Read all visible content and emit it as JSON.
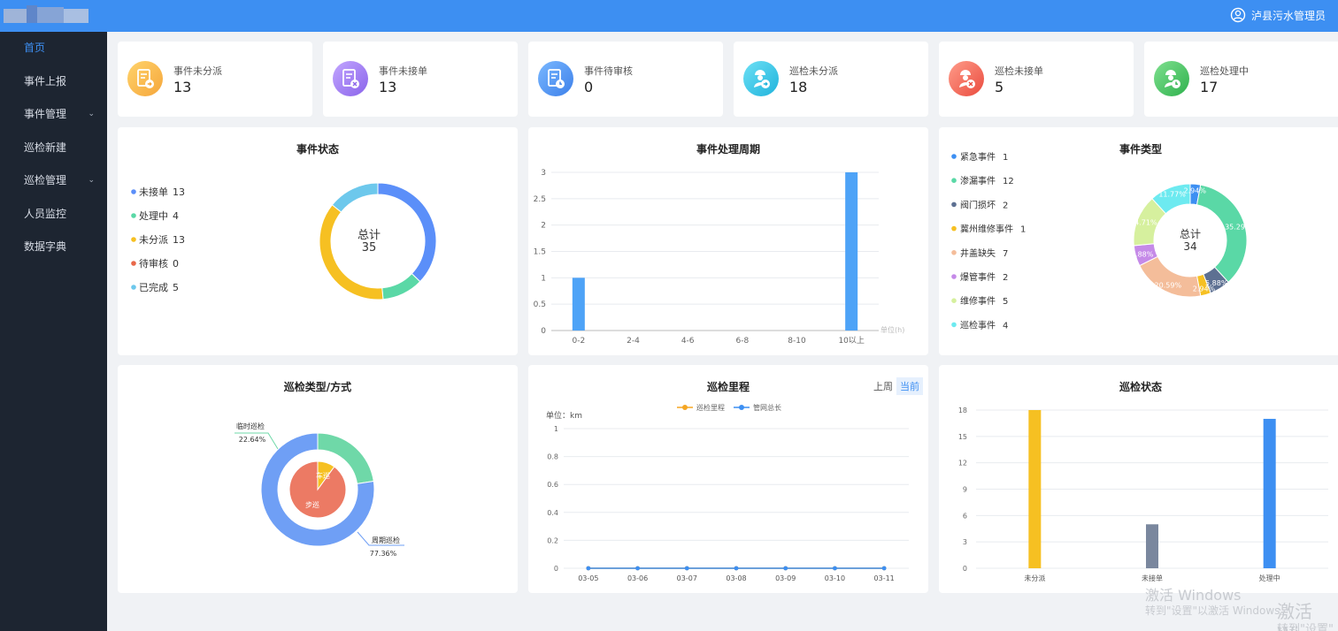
{
  "header": {
    "user_label": "泸县污水管理员"
  },
  "sidebar": {
    "items": [
      {
        "label": "首页"
      },
      {
        "label": "事件上报"
      },
      {
        "label": "事件管理"
      },
      {
        "label": "巡检新建"
      },
      {
        "label": "巡检管理"
      },
      {
        "label": "人员监控"
      },
      {
        "label": "数据字典"
      }
    ]
  },
  "stats": [
    {
      "label": "事件未分派",
      "value": "13",
      "color": "#f7b54a"
    },
    {
      "label": "事件未接单",
      "value": "13",
      "color": "#a17ef0"
    },
    {
      "label": "事件待审核",
      "value": "0",
      "color": "#4e95f2"
    },
    {
      "label": "巡检未分派",
      "value": "18",
      "color": "#35c8e8"
    },
    {
      "label": "巡检未接单",
      "value": "5",
      "color": "#f2685c"
    },
    {
      "label": "巡检处理中",
      "value": "17",
      "color": "#4fc86a"
    }
  ],
  "panels": {
    "event_status": {
      "title": "事件状态",
      "center_label": "总计",
      "center_value": "35"
    },
    "cycle": {
      "title": "事件处理周期",
      "unit": "单位(h)"
    },
    "event_type": {
      "title": "事件类型",
      "center_label": "总计",
      "center_value": "34"
    },
    "patrol_type": {
      "title": "巡检类型/方式"
    },
    "mileage": {
      "title": "巡检里程",
      "unit": "单位：km",
      "toggle_prev": "上周",
      "toggle_current": "当前"
    },
    "patrol_status": {
      "title": "巡检状态"
    }
  },
  "watermark": {
    "line1": "激活 Windows",
    "line2": "转到\"设置\"以激活 Windows。",
    "line3": "激活 Wi",
    "line4": "转到\"设置\""
  },
  "chart_data": [
    {
      "type": "pie",
      "title": "事件状态",
      "slices": [
        {
          "label": "未接单",
          "value": 13,
          "color": "#5b8ff9"
        },
        {
          "label": "处理中",
          "value": 4,
          "color": "#5ad8a6"
        },
        {
          "label": "未分派",
          "value": 13,
          "color": "#f6c022"
        },
        {
          "label": "待审核",
          "value": 0,
          "color": "#e8684a"
        },
        {
          "label": "已完成",
          "value": 5,
          "color": "#6dc8ec"
        }
      ]
    },
    {
      "type": "bar",
      "title": "事件处理周期",
      "categories": [
        "0-2",
        "2-4",
        "4-6",
        "6-8",
        "8-10",
        "10以上"
      ],
      "values": [
        1,
        0,
        0,
        0,
        0,
        3
      ],
      "ylim": [
        0,
        3
      ],
      "yticks": [
        "0",
        "0.5",
        "1",
        "1.5",
        "2",
        "2.5",
        "3"
      ],
      "color": "#4ea3f7"
    },
    {
      "type": "pie",
      "title": "事件类型",
      "slices": [
        {
          "label": "紧急事件",
          "value": 1,
          "color": "#3d8ff2",
          "pct": "2.94%"
        },
        {
          "label": "渗漏事件",
          "value": 12,
          "color": "#5ad8a6",
          "pct": "35.29%"
        },
        {
          "label": "阀门损坏",
          "value": 2,
          "color": "#5d7092",
          "pct": "5.88%"
        },
        {
          "label": "冀州维修事件",
          "value": 1,
          "color": "#f6c022",
          "pct": "2.94%"
        },
        {
          "label": "井盖缺失",
          "value": 7,
          "color": "#f4bd9a",
          "pct": "20.59%"
        },
        {
          "label": "爆管事件",
          "value": 2,
          "color": "#c58ae8",
          "pct": "5.88%"
        },
        {
          "label": "维修事件",
          "value": 5,
          "color": "#d6f09e",
          "pct": "14.71%"
        },
        {
          "label": "巡检事件",
          "value": 4,
          "color": "#6deaf0",
          "pct": "11.77%"
        }
      ]
    },
    {
      "type": "pie",
      "title": "巡检类型/方式",
      "outer": [
        {
          "label": "临时巡检",
          "value": 22.64,
          "pct": "22.64%",
          "color": "#6fd8a8"
        },
        {
          "label": "周期巡检",
          "value": 77.36,
          "pct": "77.36%",
          "color": "#6f9ff5"
        }
      ],
      "inner": [
        {
          "label": "车巡",
          "value": 10,
          "color": "#f6c022"
        },
        {
          "label": "步巡",
          "value": 90,
          "color": "#ec7a64"
        }
      ]
    },
    {
      "type": "line",
      "title": "巡检里程",
      "x": [
        "03-05",
        "03-06",
        "03-07",
        "03-08",
        "03-09",
        "03-10",
        "03-11"
      ],
      "series": [
        {
          "name": "巡检里程",
          "values": [
            0,
            0,
            0,
            0,
            0,
            0,
            0
          ],
          "color": "#f5a623"
        },
        {
          "name": "管网总长",
          "values": [
            0,
            0,
            0,
            0,
            0,
            0,
            0
          ],
          "color": "#3d8ff2"
        }
      ],
      "ylim": [
        0,
        1
      ],
      "yticks": [
        "0",
        "0.2",
        "0.4",
        "0.6",
        "0.8",
        "1"
      ]
    },
    {
      "type": "bar",
      "title": "巡检状态",
      "categories": [
        "未分派",
        "未接单",
        "处理中"
      ],
      "values": [
        18,
        5,
        17
      ],
      "colors": [
        "#f6c022",
        "#7a879e",
        "#3d8ff2"
      ],
      "ylim": [
        0,
        18
      ],
      "yticks": [
        "0",
        "3",
        "6",
        "9",
        "12",
        "15",
        "18"
      ]
    }
  ]
}
